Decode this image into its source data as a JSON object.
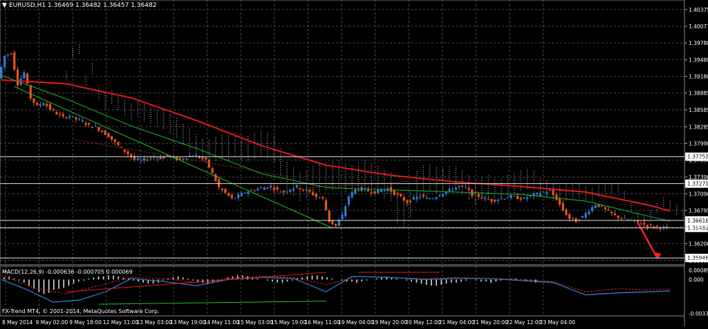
{
  "chart_header": {
    "symbol_info": "EURUSD,H1  1.36469 1.36482 1.36457 1.36482",
    "menu_arrow": "triangle-down-icon"
  },
  "indicator_header": "MACD(12,26,9) -0.000636 -0.000705 0.000069",
  "copyright": "FX-Trend MT4, © 2001-2014, MetaQuotes Software Corp.",
  "colors": {
    "background": "#000000",
    "grid": "#4a4a4a",
    "candle_up": "#2e7bd6",
    "candle_down": "#e8541f",
    "slow_ma": "#e01b1b",
    "fast_ma": "#1f9d2a",
    "trendline": "#29c129",
    "cloud": "#d9d9d9",
    "price_label_bg": "#ffffff"
  },
  "chart_data": [
    {
      "type": "candlestick",
      "panel": "main",
      "title": "",
      "y_axis_ticks": [
        "1.40375",
        "1.40077",
        "1.39780",
        "1.39480",
        "1.39180",
        "1.38885",
        "1.38585",
        "1.38285",
        "1.37990",
        "1.37690",
        "1.37390",
        "1.37090",
        "1.36795",
        "1.36495",
        "1.36200",
        "1.35900"
      ],
      "ylim": [
        1.3585,
        1.4052
      ],
      "horizontal_levels": [
        {
          "label": "1.37751",
          "value": 1.37751
        },
        {
          "label": "1.37271",
          "value": 1.37271
        },
        {
          "label": "1.36616",
          "value": 1.36616
        },
        {
          "label": "1.36482",
          "value": 1.36482
        },
        {
          "label": "1.35946",
          "value": 1.35946
        }
      ],
      "x_axis_labels": [
        "8 May 2014",
        "9 May 02:00",
        "9 May 18:00",
        "12 May 11:00",
        "13 May 03:00",
        "13 May 19:00",
        "14 May 11:00",
        "15 May 03:00",
        "15 May 19:00",
        "16 May 11:00",
        "19 May 04:00",
        "19 May 20:00",
        "20 May 12:00",
        "21 May 04:00",
        "21 May 20:00",
        "22 May 12:00",
        "23 May 04:00"
      ],
      "close_path": [
        [
          0,
          1.3915
        ],
        [
          2,
          1.3955
        ],
        [
          4,
          1.396
        ],
        [
          6,
          1.3905
        ],
        [
          8,
          1.3925
        ],
        [
          10,
          1.388
        ],
        [
          12,
          1.3865
        ],
        [
          14,
          1.3872
        ],
        [
          16,
          1.386
        ],
        [
          18,
          1.3852
        ],
        [
          20,
          1.3845
        ],
        [
          22,
          1.3848
        ],
        [
          24,
          1.3842
        ],
        [
          26,
          1.3838
        ],
        [
          28,
          1.383
        ],
        [
          30,
          1.3828
        ],
        [
          32,
          1.382
        ],
        [
          34,
          1.3812
        ],
        [
          36,
          1.38
        ],
        [
          38,
          1.379
        ],
        [
          40,
          1.378
        ],
        [
          42,
          1.377
        ],
        [
          44,
          1.3768
        ],
        [
          46,
          1.3772
        ],
        [
          48,
          1.3775
        ],
        [
          50,
          1.3773
        ],
        [
          52,
          1.3778
        ],
        [
          54,
          1.3772
        ],
        [
          56,
          1.377
        ],
        [
          58,
          1.3775
        ],
        [
          60,
          1.3778
        ],
        [
          62,
          1.3774
        ],
        [
          64,
          1.3768
        ],
        [
          66,
          1.3745
        ],
        [
          68,
          1.372
        ],
        [
          70,
          1.371
        ],
        [
          72,
          1.37
        ],
        [
          74,
          1.3705
        ],
        [
          76,
          1.3712
        ],
        [
          78,
          1.3715
        ],
        [
          80,
          1.3718
        ],
        [
          82,
          1.372
        ],
        [
          84,
          1.3722
        ],
        [
          86,
          1.3715
        ],
        [
          88,
          1.3712
        ],
        [
          90,
          1.3718
        ],
        [
          92,
          1.3722
        ],
        [
          94,
          1.3716
        ],
        [
          96,
          1.3712
        ],
        [
          98,
          1.3704
        ],
        [
          100,
          1.37
        ],
        [
          102,
          1.366
        ],
        [
          104,
          1.3652
        ],
        [
          106,
          1.367
        ],
        [
          108,
          1.3705
        ],
        [
          110,
          1.3716
        ],
        [
          112,
          1.3718
        ],
        [
          114,
          1.3714
        ],
        [
          116,
          1.3712
        ],
        [
          118,
          1.3716
        ],
        [
          120,
          1.3718
        ],
        [
          122,
          1.371
        ],
        [
          124,
          1.3702
        ],
        [
          126,
          1.3694
        ],
        [
          128,
          1.37
        ],
        [
          130,
          1.3705
        ],
        [
          132,
          1.37
        ],
        [
          134,
          1.3702
        ],
        [
          136,
          1.3708
        ],
        [
          138,
          1.3712
        ],
        [
          140,
          1.3718
        ],
        [
          142,
          1.3722
        ],
        [
          144,
          1.372
        ],
        [
          146,
          1.3708
        ],
        [
          148,
          1.3705
        ],
        [
          150,
          1.37
        ],
        [
          152,
          1.3697
        ],
        [
          154,
          1.37
        ],
        [
          156,
          1.3702
        ],
        [
          158,
          1.3704
        ],
        [
          160,
          1.3702
        ],
        [
          162,
          1.37
        ],
        [
          164,
          1.3706
        ],
        [
          166,
          1.3708
        ],
        [
          168,
          1.3712
        ],
        [
          170,
          1.3714
        ],
        [
          172,
          1.37
        ],
        [
          174,
          1.368
        ],
        [
          176,
          1.3665
        ],
        [
          178,
          1.366
        ],
        [
          180,
          1.3668
        ],
        [
          182,
          1.368
        ],
        [
          184,
          1.369
        ],
        [
          186,
          1.3685
        ],
        [
          188,
          1.3676
        ],
        [
          190,
          1.367
        ],
        [
          192,
          1.3665
        ],
        [
          194,
          1.3662
        ],
        [
          196,
          1.366
        ],
        [
          198,
          1.3656
        ],
        [
          200,
          1.3652
        ],
        [
          202,
          1.365
        ],
        [
          204,
          1.3649
        ],
        [
          206,
          1.3648
        ]
      ],
      "slow_ma_path": [
        [
          0,
          1.3912
        ],
        [
          20,
          1.3905
        ],
        [
          40,
          1.388
        ],
        [
          60,
          1.384
        ],
        [
          80,
          1.3795
        ],
        [
          100,
          1.376
        ],
        [
          120,
          1.3742
        ],
        [
          140,
          1.373
        ],
        [
          160,
          1.3722
        ],
        [
          180,
          1.3712
        ],
        [
          200,
          1.3688
        ],
        [
          206,
          1.3678
        ]
      ],
      "fast_ma_path": [
        [
          0,
          1.392
        ],
        [
          20,
          1.3878
        ],
        [
          40,
          1.383
        ],
        [
          60,
          1.379
        ],
        [
          80,
          1.3745
        ],
        [
          100,
          1.372
        ],
        [
          120,
          1.3716
        ],
        [
          140,
          1.3712
        ],
        [
          160,
          1.3708
        ],
        [
          180,
          1.3696
        ],
        [
          200,
          1.3668
        ],
        [
          206,
          1.366
        ]
      ],
      "trendlines": [
        {
          "from": [
            4,
            1.39
          ],
          "to": [
            102,
            1.3648
          ]
        },
        {
          "from": [
            22,
            1.3806
          ],
          "to": [
            88,
            1.374
          ]
        },
        {
          "from": [
            90,
            1.3718
          ],
          "to": [
            128,
            1.3732
          ]
        }
      ],
      "forecast_arrow": {
        "from": [
          196,
          1.3658
        ],
        "to": [
          202,
          1.3595
        ]
      }
    },
    {
      "type": "histogram",
      "panel": "indicator",
      "title": "",
      "y_axis_ticks": [
        "0.000892",
        "0.000",
        "-0.003316"
      ],
      "ylim": [
        -0.0034,
        0.0011
      ],
      "histogram_values": [
        0.0002,
        0.0003,
        0.0001,
        -0.0001,
        -0.0003,
        -0.0006,
        -0.0009,
        -0.0012,
        -0.0014,
        -0.0013,
        -0.001,
        -0.0009,
        -0.0008,
        -0.0006,
        -0.0004,
        -0.0002,
        -0.0001,
        0.0001,
        0.0002,
        0.0003,
        0.0003,
        0.0004,
        0.0004,
        0.0003,
        0.0002,
        0.0001,
        -0.0001,
        -0.0002,
        -0.0003,
        -0.0004,
        -0.0004,
        -0.0003,
        -0.0001,
        0.0001,
        0.0002,
        0.0003,
        0.0002,
        0.0001,
        -0.0001,
        -0.0002,
        -0.0003,
        -0.0004,
        -0.0003,
        -0.0002,
        0.0,
        0.0002,
        0.0003,
        0.0004,
        0.0004,
        0.0003,
        0.0002,
        0.0001,
        0.0,
        -0.0001,
        -0.0002,
        -0.0003,
        -0.0003,
        -0.0002,
        -0.0001,
        0.0001,
        0.0002,
        0.0003,
        0.0004,
        0.0004,
        0.0003,
        0.0002,
        0.0001,
        0.0,
        -0.0001,
        -0.0002,
        -0.0002,
        -0.0003,
        -0.0002,
        -0.0001,
        0.0,
        0.0001,
        0.0002,
        0.0003,
        0.0002,
        0.0001,
        0.0,
        -0.0001,
        -0.0002,
        -0.0003,
        -0.0004,
        -0.0005,
        -0.0006,
        -0.0006,
        -0.0005,
        -0.0004,
        -0.0003,
        -0.0003,
        -0.0002,
        -0.0001,
        0.0,
        -0.0001,
        -0.0002,
        -0.0002,
        -0.0003,
        -0.0002,
        -0.0001,
        0.0,
        0.0001,
        0.0001,
        0.0,
        -0.0001,
        -0.0002,
        -0.0003
      ],
      "signal_path": [
        [
          0,
          0.0004
        ],
        [
          10,
          -0.0008
        ],
        [
          20,
          -0.0014
        ],
        [
          30,
          -0.0006
        ],
        [
          40,
          0.0002
        ],
        [
          50,
          0.0001
        ],
        [
          60,
          -0.0003
        ],
        [
          70,
          0.0001
        ],
        [
          80,
          0.0003
        ],
        [
          90,
          0.0002
        ],
        [
          100,
          -0.0005
        ],
        [
          110,
          0.0003
        ],
        [
          120,
          0.0002
        ],
        [
          130,
          0.0001
        ],
        [
          140,
          0.0002
        ],
        [
          150,
          0.0001
        ],
        [
          160,
          0.0
        ],
        [
          170,
          -0.0002
        ],
        [
          180,
          -0.0012
        ],
        [
          190,
          -0.0009
        ],
        [
          200,
          -0.001
        ],
        [
          206,
          -0.0009
        ]
      ],
      "macd_line_path": [
        [
          0,
          0.0
        ],
        [
          8,
          -0.001
        ],
        [
          16,
          -0.0022
        ],
        [
          24,
          -0.002
        ],
        [
          32,
          -0.0012
        ],
        [
          40,
          0.0001
        ],
        [
          50,
          -0.0002
        ],
        [
          60,
          -0.0006
        ],
        [
          70,
          0.0
        ],
        [
          80,
          0.0002
        ],
        [
          90,
          0.0001
        ],
        [
          100,
          -0.0012
        ],
        [
          108,
          0.0003
        ],
        [
          120,
          0.0002
        ],
        [
          130,
          0.0
        ],
        [
          140,
          0.0001
        ],
        [
          150,
          0.0001
        ],
        [
          160,
          -0.0001
        ],
        [
          170,
          -0.0003
        ],
        [
          180,
          -0.0015
        ],
        [
          190,
          -0.0013
        ],
        [
          200,
          -0.0012
        ],
        [
          206,
          -0.0011
        ]
      ],
      "divergence_lines": [
        {
          "color": "#e01b1b",
          "from": [
            20,
            -0.0012
          ],
          "to": [
            100,
            0.0007
          ]
        },
        {
          "color": "#29c129",
          "from": [
            30,
            -0.0024
          ],
          "to": [
            100,
            -0.0021
          ]
        },
        {
          "color": "#e01b1b",
          "from": [
            110,
            0.0007
          ],
          "to": [
            135,
            0.0007
          ]
        }
      ]
    }
  ]
}
